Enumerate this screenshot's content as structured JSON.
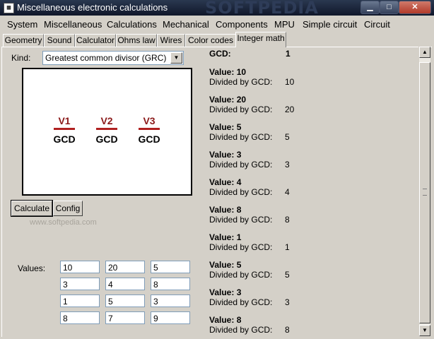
{
  "window": {
    "title": "Miscellaneous electronic calculations",
    "watermark": "SOFTPEDIA"
  },
  "menu": [
    "System",
    "Miscellaneous",
    "Calculations",
    "Mechanical",
    "Components",
    "MPU",
    "Simple circuit",
    "Circuit"
  ],
  "tabs": [
    "Geometry",
    "Sound",
    "Calculator",
    "Ohms law",
    "Wires",
    "Color codes",
    "Integer math"
  ],
  "kind": {
    "label": "Kind:",
    "selected": "Greatest common divisor (GRC)"
  },
  "diagram": {
    "vars": [
      "V1",
      "V2",
      "V3"
    ],
    "gcd": "GCD"
  },
  "buttons": {
    "calculate": "Calculate",
    "config": "Config"
  },
  "faint_watermark": "www.softpedia.com",
  "values": {
    "label": "Values:",
    "rows": [
      [
        "10",
        "20",
        "5"
      ],
      [
        "3",
        "4",
        "8"
      ],
      [
        "1",
        "5",
        "3"
      ],
      [
        "8",
        "7",
        "9"
      ]
    ]
  },
  "results": {
    "gcd_label": "GCD:",
    "gcd_value": "1",
    "value_prefix": "Value:",
    "divided_label": "Divided by GCD:",
    "items": [
      {
        "value": "10",
        "divided": "10"
      },
      {
        "value": "20",
        "divided": "20"
      },
      {
        "value": "5",
        "divided": "5"
      },
      {
        "value": "3",
        "divided": "3"
      },
      {
        "value": "4",
        "divided": "4"
      },
      {
        "value": "8",
        "divided": "8"
      },
      {
        "value": "1",
        "divided": "1"
      },
      {
        "value": "5",
        "divided": "5"
      },
      {
        "value": "3",
        "divided": "3"
      },
      {
        "value": "8",
        "divided": "8"
      }
    ]
  }
}
